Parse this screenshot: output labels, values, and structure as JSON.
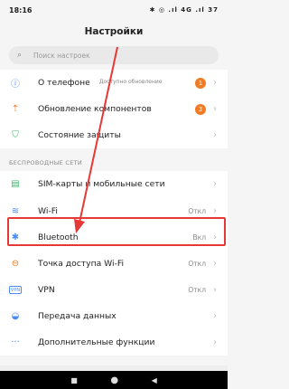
{
  "status": {
    "time": "18:16",
    "icons": "✱ ◎ .ıl 4G .ıl 37"
  },
  "header": {
    "title": "Настройки"
  },
  "search": {
    "placeholder": "Поиск настроек"
  },
  "top_items": [
    {
      "label": "О телефоне",
      "sub": "Доступно обновление",
      "badge": "1"
    },
    {
      "label": "Обновление компонентов",
      "badge": "3"
    },
    {
      "label": "Состояние защиты"
    }
  ],
  "section": {
    "wireless": "БЕСПРОВОДНЫЕ СЕТИ"
  },
  "wireless_items": [
    {
      "label": "SIM-карты и мобильные сети",
      "value": ""
    },
    {
      "label": "Wi-Fi",
      "value": "Откл"
    },
    {
      "label": "Bluetooth",
      "value": "Вкл"
    },
    {
      "label": "Точка доступа Wi-Fi",
      "value": "Откл"
    },
    {
      "label": "VPN",
      "value": "Откл"
    },
    {
      "label": "Передача данных",
      "value": ""
    },
    {
      "label": "Дополнительные функции",
      "value": ""
    }
  ],
  "colors": {
    "accent": "#f27a22",
    "highlight": "#e53935"
  }
}
